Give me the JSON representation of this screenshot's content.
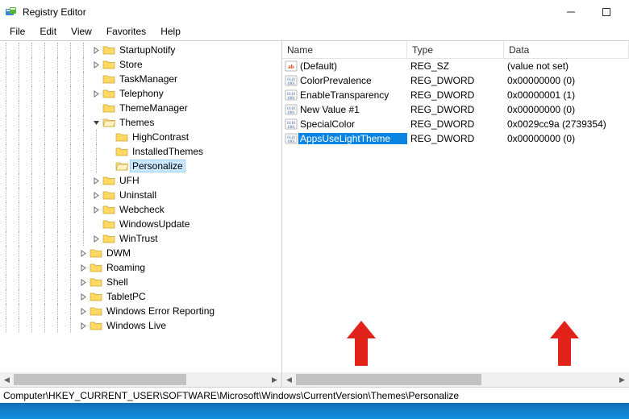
{
  "window": {
    "title": "Registry Editor"
  },
  "menubar": [
    "File",
    "Edit",
    "View",
    "Favorites",
    "Help"
  ],
  "tree": [
    {
      "depth": 7,
      "exp": ">",
      "label": "StartupNotify"
    },
    {
      "depth": 7,
      "exp": ">",
      "label": "Store"
    },
    {
      "depth": 7,
      "exp": "",
      "label": "TaskManager"
    },
    {
      "depth": 7,
      "exp": ">",
      "label": "Telephony"
    },
    {
      "depth": 7,
      "exp": "",
      "label": "ThemeManager"
    },
    {
      "depth": 7,
      "exp": "v",
      "label": "Themes"
    },
    {
      "depth": 8,
      "exp": "",
      "label": "HighContrast"
    },
    {
      "depth": 8,
      "exp": "",
      "label": "InstalledThemes"
    },
    {
      "depth": 8,
      "exp": "",
      "label": "Personalize",
      "selected": true
    },
    {
      "depth": 7,
      "exp": ">",
      "label": "UFH"
    },
    {
      "depth": 7,
      "exp": ">",
      "label": "Uninstall"
    },
    {
      "depth": 7,
      "exp": ">",
      "label": "Webcheck"
    },
    {
      "depth": 7,
      "exp": "",
      "label": "WindowsUpdate"
    },
    {
      "depth": 7,
      "exp": ">",
      "label": "WinTrust"
    },
    {
      "depth": 6,
      "exp": ">",
      "label": "DWM"
    },
    {
      "depth": 6,
      "exp": ">",
      "label": "Roaming"
    },
    {
      "depth": 6,
      "exp": ">",
      "label": "Shell"
    },
    {
      "depth": 6,
      "exp": ">",
      "label": "TabletPC"
    },
    {
      "depth": 6,
      "exp": ">",
      "label": "Windows Error Reporting"
    },
    {
      "depth": 6,
      "exp": ">",
      "label": "Windows Live"
    }
  ],
  "columns": {
    "name": "Name",
    "type": "Type",
    "data": "Data"
  },
  "values": [
    {
      "icon": "sz",
      "name": "(Default)",
      "type": "REG_SZ",
      "data": "(value not set)"
    },
    {
      "icon": "bin",
      "name": "ColorPrevalence",
      "type": "REG_DWORD",
      "data": "0x00000000 (0)"
    },
    {
      "icon": "bin",
      "name": "EnableTransparency",
      "type": "REG_DWORD",
      "data": "0x00000001 (1)"
    },
    {
      "icon": "bin",
      "name": "New Value #1",
      "type": "REG_DWORD",
      "data": "0x00000000 (0)"
    },
    {
      "icon": "bin",
      "name": "SpecialColor",
      "type": "REG_DWORD",
      "data": "0x0029cc9a (2739354)"
    },
    {
      "icon": "bin",
      "name": "AppsUseLightTheme",
      "type": "REG_DWORD",
      "data": "0x00000000 (0)",
      "selected": true
    }
  ],
  "statusbar": "Computer\\HKEY_CURRENT_USER\\SOFTWARE\\Microsoft\\Windows\\CurrentVersion\\Themes\\Personalize",
  "scroll": {
    "tree_thumb_pct": 68,
    "values_thumb_pct": 58
  }
}
